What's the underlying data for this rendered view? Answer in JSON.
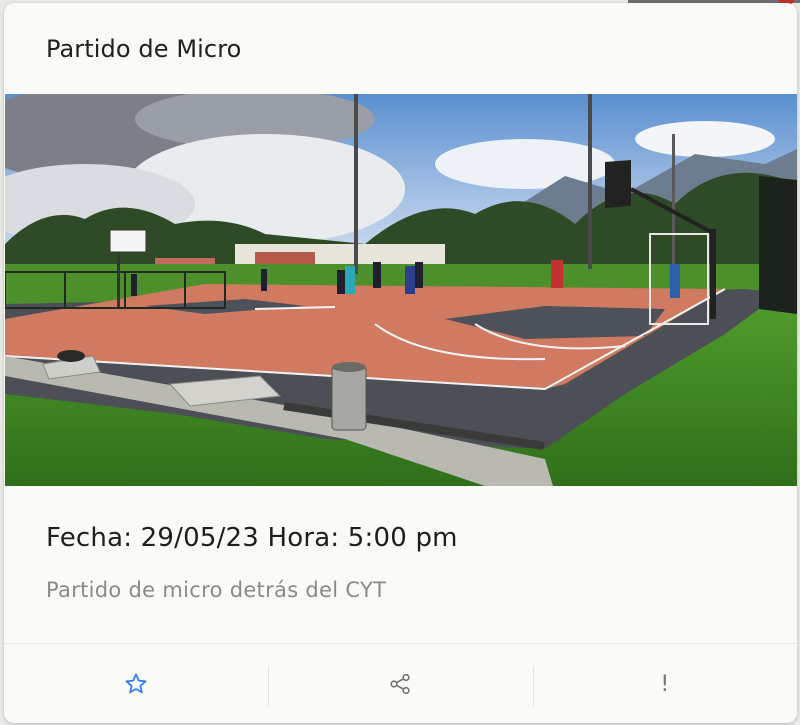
{
  "card": {
    "title": "Partido de Micro",
    "date_line": "Fecha: 29/05/23 Hora: 5:00 pm",
    "description": "Partido de micro detrás del CYT"
  },
  "photo": {
    "subject": "outdoor basketball court with players"
  },
  "actions": [
    {
      "icon": "star-icon",
      "color": "#2f80ed"
    },
    {
      "icon": "share-icon",
      "color": "#6f6f6f"
    },
    {
      "icon": "exclamation-icon",
      "label": "!",
      "color": "#6f6f6f"
    }
  ],
  "colors": {
    "accent": "#2f80ed",
    "card_bg": "#fafaf6",
    "title_text": "#202020",
    "muted_text": "#8a8a8a"
  }
}
